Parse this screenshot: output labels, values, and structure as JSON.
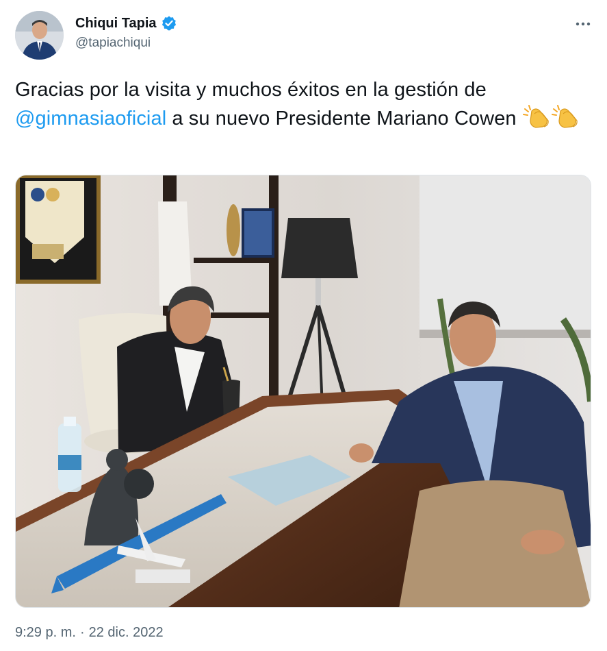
{
  "author": {
    "display_name": "Chiqui Tapia",
    "handle": "@tapiachiqui",
    "verified": true
  },
  "icons": {
    "verified": "verified-badge-icon",
    "more": "more-options-icon",
    "emoji": "clapping-hands-emoji"
  },
  "tweet": {
    "text_before": "Gracias por la visita y muchos éxitos en la gestión de ",
    "mention": "@gimnasiaoficial",
    "text_after": " a su nuevo Presidente Mariano Cowen "
  },
  "meta": {
    "time": "9:29 p. m.",
    "separator": "·",
    "date": "22 dic. 2022"
  },
  "colors": {
    "accent": "#1d9bf0",
    "secondary_text": "#536471",
    "primary_text": "#0f1419"
  }
}
